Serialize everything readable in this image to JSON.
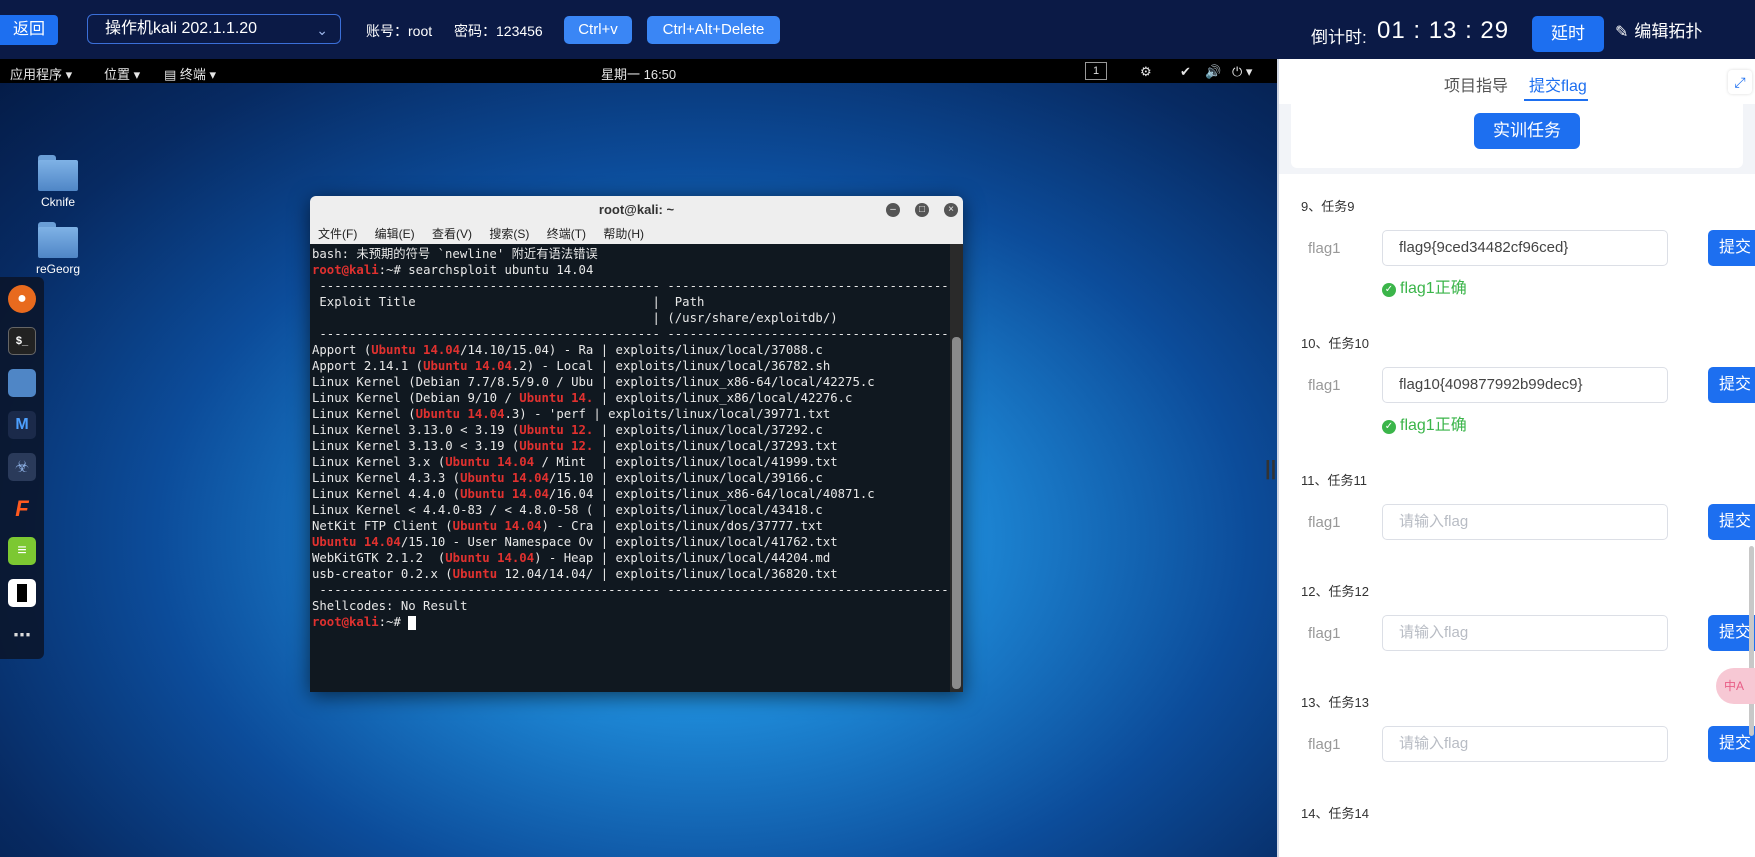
{
  "topbar": {
    "back": "返回",
    "vm_name": "操作机kali 202.1.1.20",
    "account_label": "账号",
    "account_value": "root",
    "password_label": "密码",
    "password_value": "123456",
    "ctrl_v": "Ctrl+v",
    "ctrl_alt_del": "Ctrl+Alt+Delete",
    "countdown_label": "倒计时",
    "countdown_value": "01 : 13 : 29",
    "delay": "延时",
    "edit_topology": "编辑拓扑"
  },
  "kali_panel": {
    "applications": "应用程序",
    "places": "位置",
    "terminal": "终端",
    "clock": "星期一 16:50",
    "workspace": "1"
  },
  "desktop_icons": [
    {
      "label": "Cknife"
    },
    {
      "label": "reGeorg"
    }
  ],
  "terminal": {
    "title": "root@kali: ~",
    "menu": [
      "文件(F)",
      "编辑(E)",
      "查看(V)",
      "搜索(S)",
      "终端(T)",
      "帮助(H)"
    ],
    "line_error": "bash: 未预期的符号 `newline' 附近有语法错误",
    "prompt_user": "root@kali",
    "prompt_rest": ":~# ",
    "command": "searchsploit ubuntu 14.04",
    "separator": " ---------------------------------------------- ----------------------------------------",
    "header_title": " Exploit Title                                |  Path",
    "header_path": "                                              | (/usr/share/exploitdb/)",
    "rows": [
      [
        "Apport (",
        "Ubuntu 14.04",
        "/14.10/15.04) - Ra | exploits/linux/local/37088.c"
      ],
      [
        "Apport 2.14.1 (",
        "Ubuntu 14.04",
        ".2) - Local | exploits/linux/local/36782.sh"
      ],
      [
        "Linux Kernel (Debian 7.7/8.5/9.0 / Ubu | exploits/linux_x86-64/local/42275.c",
        "",
        ""
      ],
      [
        "Linux Kernel (Debian 9/10 / ",
        "Ubuntu 14.",
        " | exploits/linux_x86/local/42276.c"
      ],
      [
        "Linux Kernel (",
        "Ubuntu 14.04",
        ".3) - 'perf | exploits/linux/local/39771.txt"
      ],
      [
        "Linux Kernel 3.13.0 < 3.19 (",
        "Ubuntu 12.",
        " | exploits/linux/local/37292.c"
      ],
      [
        "Linux Kernel 3.13.0 < 3.19 (",
        "Ubuntu 12.",
        " | exploits/linux/local/37293.txt"
      ],
      [
        "Linux Kernel 3.x (",
        "Ubuntu 14.04",
        " / Mint  | exploits/linux/local/41999.txt"
      ],
      [
        "Linux Kernel 4.3.3 (",
        "Ubuntu 14.04",
        "/15.10 | exploits/linux/local/39166.c"
      ],
      [
        "Linux Kernel 4.4.0 (",
        "Ubuntu 14.04",
        "/16.04 | exploits/linux_x86-64/local/40871.c"
      ],
      [
        "Linux Kernel < 4.4.0-83 / < 4.8.0-58 ( | exploits/linux/local/43418.c",
        "",
        ""
      ],
      [
        "NetKit FTP Client (",
        "Ubuntu 14.04",
        ") - Cra | exploits/linux/dos/37777.txt"
      ],
      [
        "",
        "Ubuntu 14.04",
        "/15.10 - User Namespace Ov | exploits/linux/local/41762.txt"
      ],
      [
        "WebKitGTK 2.1.2  (",
        "Ubuntu 14.04",
        ") - Heap | exploits/linux/local/44204.md"
      ],
      [
        "usb-creator 0.2.x (",
        "Ubuntu",
        " 12.04/14.04/ | exploits/linux/local/36820.txt"
      ]
    ],
    "shellcodes": "Shellcodes: No Result"
  },
  "panel": {
    "tab_guide": "项目指导",
    "tab_submit": "提交flag",
    "task_button": "实训任务",
    "tasks": [
      {
        "title": "9、任务9",
        "label": "flag1",
        "value": "flag9{9ced34482cf96ced}",
        "status": "flag1正确",
        "button": "提交"
      },
      {
        "title": "10、任务10",
        "label": "flag1",
        "value": "flag10{409877992b99dec9}",
        "status": "flag1正确",
        "button": "提交"
      },
      {
        "title": "11、任务11",
        "label": "flag1",
        "placeholder": "请输入flag",
        "button": "提交"
      },
      {
        "title": "12、任务12",
        "label": "flag1",
        "placeholder": "请输入flag",
        "button": "提交"
      },
      {
        "title": "13、任务13",
        "label": "flag1",
        "placeholder": "请输入flag",
        "button": "提交"
      },
      {
        "title": "14、任务14"
      }
    ],
    "badge": "中A"
  },
  "colors": {
    "accent": "#1d6ff0",
    "success": "#3bb54a",
    "topbar": "#0b1a46",
    "terminal_red": "#e0312f"
  }
}
